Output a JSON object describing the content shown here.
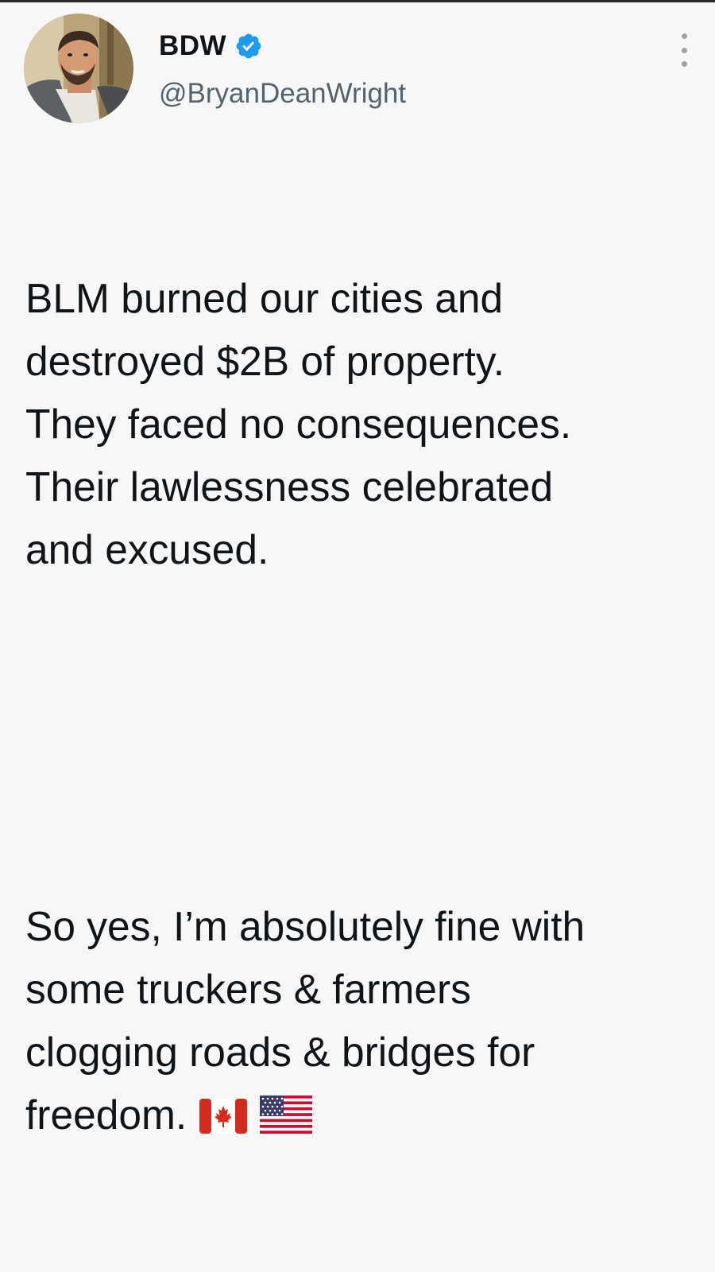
{
  "tweet": {
    "author": {
      "display_name": "BDW",
      "handle": "@BryanDeanWright",
      "verified": true,
      "verified_color": "#1d9bf0"
    },
    "more_icon": "more-vertical-icon",
    "paragraphs": [
      "BLM burned our cities and\ndestroyed $2B of property.\nThey faced no consequences.\nTheir lawlessness celebrated\nand excused.",
      "So yes, I’m absolutely fine with\nsome truckers & farmers\nclogging roads & bridges for\nfreedom."
    ],
    "trailing_emoji": [
      "canada-flag-icon",
      "us-flag-icon"
    ]
  }
}
